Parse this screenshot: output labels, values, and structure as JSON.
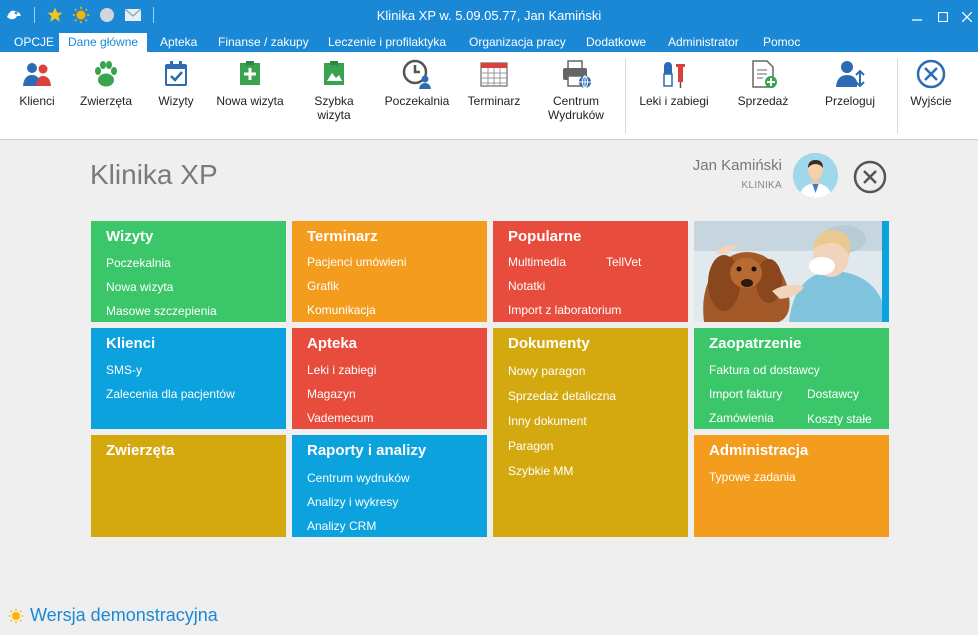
{
  "window": {
    "title": "Klinika XP w. 5.09.05.77, Jan Kamiński"
  },
  "menu": {
    "tabs": [
      {
        "label": "OPCJE"
      },
      {
        "label": "Dane główne"
      },
      {
        "label": "Apteka"
      },
      {
        "label": "Finanse / zakupy"
      },
      {
        "label": "Leczenie i profilaktyka"
      },
      {
        "label": "Organizacja pracy"
      },
      {
        "label": "Dodatkowe"
      },
      {
        "label": "Administrator"
      },
      {
        "label": "Pomoc"
      }
    ],
    "active_tab": "Dane główne"
  },
  "ribbon": {
    "buttons": [
      {
        "label": "Klienci",
        "icon": "clients-icon"
      },
      {
        "label": "Zwierzęta",
        "icon": "paw-icon"
      },
      {
        "label": "Wizyty",
        "icon": "calendar-check-icon"
      },
      {
        "label": "Nowa wizyta",
        "icon": "add-visit-icon"
      },
      {
        "label": "Szybka wizyta",
        "icon": "quick-visit-icon"
      },
      {
        "label": "Poczekalnia",
        "icon": "clock-user-icon"
      },
      {
        "label": "Terminarz",
        "icon": "schedule-icon"
      },
      {
        "label": "Centrum",
        "label2": "Wydruków",
        "icon": "printer-icon"
      },
      {
        "label": "Leki i zabiegi",
        "icon": "medicine-icon"
      },
      {
        "label": "Sprzedaż",
        "icon": "sale-document-icon"
      },
      {
        "label": "Przeloguj",
        "icon": "relogin-icon"
      },
      {
        "label": "Wyjście",
        "icon": "exit-icon"
      }
    ]
  },
  "header": {
    "app_title": "Klinika XP",
    "user_name": "Jan Kamiński",
    "user_role": "KLINIKA"
  },
  "tiles": {
    "wizyty": {
      "title": "Wizyty",
      "items": [
        "Poczekalnia",
        "Nowa wizyta",
        "Masowe szczepienia"
      ]
    },
    "terminarz": {
      "title": "Terminarz",
      "items": [
        "Pacjenci umówieni",
        "Grafik",
        "Komunikacja"
      ]
    },
    "popularne": {
      "title": "Popularne",
      "items": [
        "Multimedia",
        "TellVet",
        "Notatki",
        "Import z laboratorium"
      ]
    },
    "klienci": {
      "title": "Klienci",
      "items": [
        "SMS-y",
        "Zalecenia dla pacjentów"
      ]
    },
    "apteka": {
      "title": "Apteka",
      "items": [
        "Leki i zabiegi",
        "Magazyn",
        "Vademecum"
      ]
    },
    "dokumenty": {
      "title": "Dokumenty",
      "items": [
        "Nowy paragon",
        "Sprzedaż detaliczna",
        "Inny dokument",
        "Paragon",
        "Szybkie MM"
      ]
    },
    "zaopatrzenie": {
      "title": "Zaopatrzenie",
      "items": [
        "Faktura od dostawcy",
        "Import faktury",
        "Dostawcy",
        "Zamówienia",
        "Koszty stałe"
      ]
    },
    "zwierzeta": {
      "title": "Zwierzęta",
      "items": []
    },
    "raporty": {
      "title": "Raporty i analizy",
      "items": [
        "Centrum wydruków",
        "Analizy i wykresy",
        "Analizy CRM"
      ]
    },
    "administracja": {
      "title": "Administracja",
      "items": [
        "Typowe zadania"
      ]
    }
  },
  "footer": {
    "demo_label": "Wersja demonstracyjna"
  },
  "colors": {
    "accent": "#1b88d6",
    "green": "#3cc66a",
    "orange": "#f39c1e",
    "red": "#e74c3c",
    "blue": "#0ba2dd",
    "olive": "#d4a90f"
  }
}
